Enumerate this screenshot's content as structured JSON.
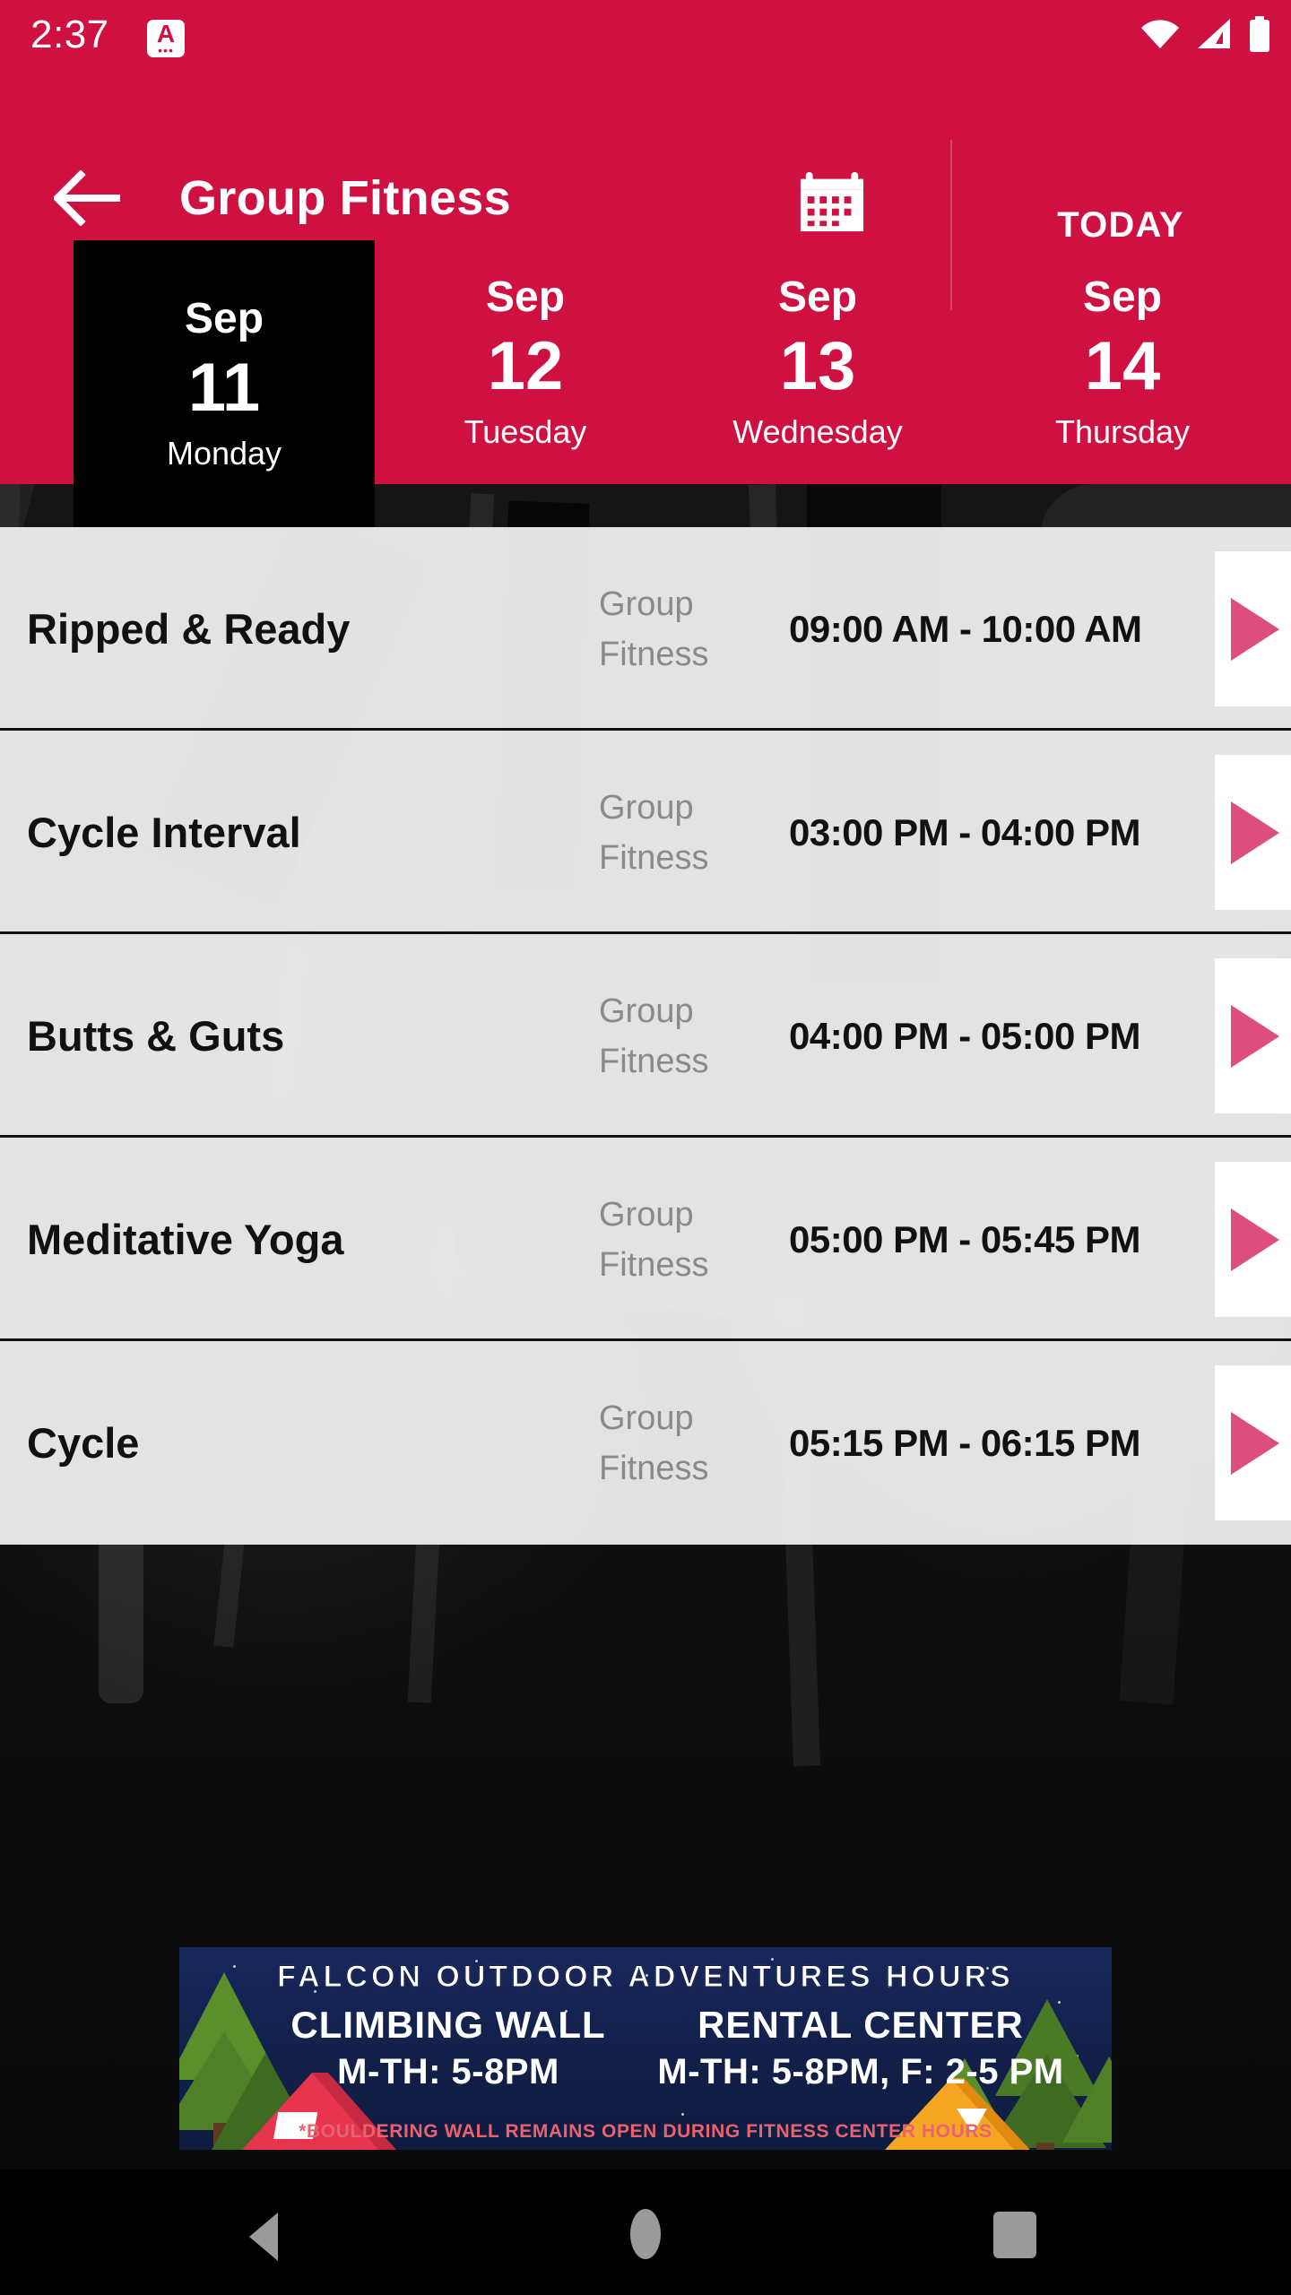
{
  "statusbar": {
    "time": "2:37",
    "notification_letter": "A",
    "notification_dots": "•••",
    "icons": [
      "wifi-icon",
      "cellular-signal-icon",
      "battery-icon"
    ]
  },
  "appbar": {
    "back_icon": "back-arrow-icon",
    "title": "Group Fitness",
    "calendar_icon": "calendar-icon",
    "today_label": "TODAY",
    "accent_color": "#CE1141"
  },
  "dates": [
    {
      "month": "Sep",
      "day": "11",
      "weekday": "Monday",
      "selected": true
    },
    {
      "month": "Sep",
      "day": "12",
      "weekday": "Tuesday",
      "selected": false
    },
    {
      "month": "Sep",
      "day": "13",
      "weekday": "Wednesday",
      "selected": false
    },
    {
      "month": "Sep",
      "day": "14",
      "weekday": "Thursday",
      "selected": false
    }
  ],
  "classes": [
    {
      "name": "Ripped & Ready",
      "category_line1": "Group",
      "category_line2": "Fitness",
      "time": "09:00 AM - 10:00 AM"
    },
    {
      "name": "Cycle Interval",
      "category_line1": "Group",
      "category_line2": "Fitness",
      "time": "03:00 PM - 04:00 PM"
    },
    {
      "name": "Butts & Guts",
      "category_line1": "Group",
      "category_line2": "Fitness",
      "time": "04:00 PM - 05:00 PM"
    },
    {
      "name": "Meditative Yoga",
      "category_line1": "Group",
      "category_line2": "Fitness",
      "time": "05:00 PM - 05:45 PM"
    },
    {
      "name": "Cycle",
      "category_line1": "Group",
      "category_line2": "Fitness",
      "time": "05:15 PM - 06:15 PM"
    }
  ],
  "list_style": {
    "arrow_color": "#DD4E7E",
    "row_bg": "#F0F0F0"
  },
  "banner": {
    "title": "FALCON OUTDOOR ADVENTURES HOURS",
    "left_heading": "CLIMBING WALL",
    "left_hours": "M-TH: 5-8PM",
    "right_heading": "RENTAL CENTER",
    "right_hours": "M-TH: 5-8PM, F: 2-5 PM",
    "footnote": "*BOULDERING WALL REMAINS OPEN DURING FITNESS CENTER HOURS",
    "bg_color": "#17275C",
    "footnote_color": "#E8626F"
  },
  "navbar": {
    "back_icon": "android-back-icon",
    "home_icon": "android-home-icon",
    "recents_icon": "android-recents-icon"
  }
}
